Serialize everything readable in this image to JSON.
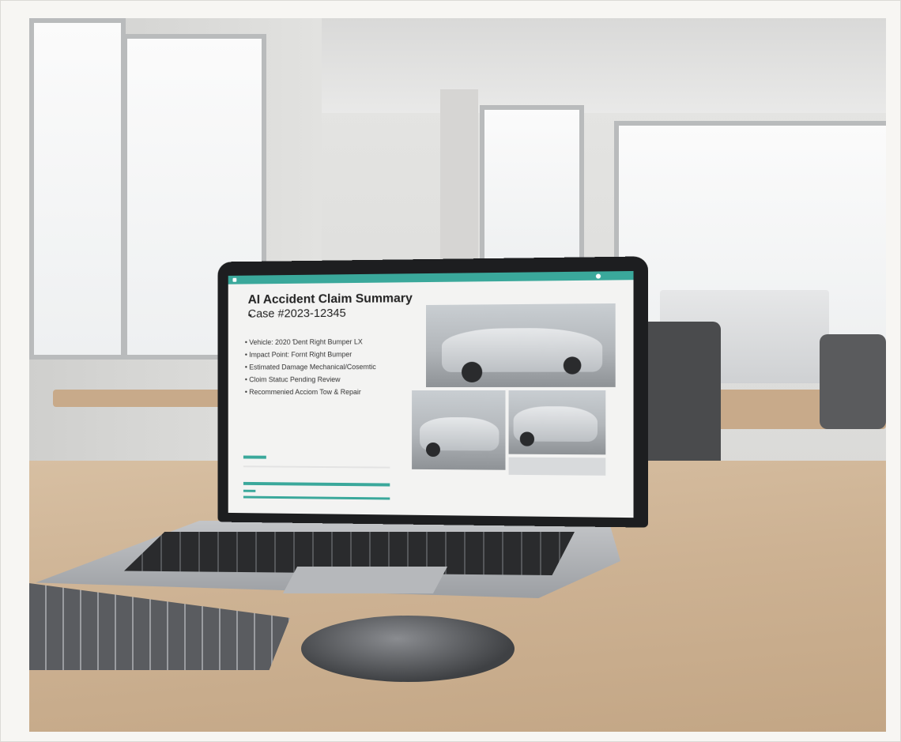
{
  "screen": {
    "title_line1": "AI Accident Claim Summary -",
    "title_line2": "Case #2023-12345",
    "bullets": [
      "Vehicle: 2020 Ɗent Right Bumper LX",
      "Impact Point: Fornt Right Bumper",
      "Estimated Damage Mechanical/Cosemtic",
      "Cloim Statuc Pending Review",
      "Recommenied Acciom Tow & Repair"
    ],
    "accent_color": "#3aa89b"
  },
  "icons": {
    "window": "app-window-icon",
    "status": "status-dot-icon"
  }
}
